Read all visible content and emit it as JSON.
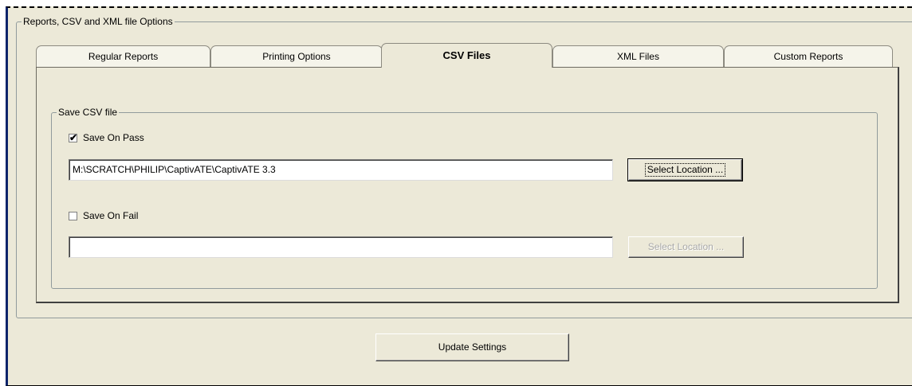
{
  "outer_group": {
    "title": "Reports, CSV and XML file Options"
  },
  "tabs": [
    {
      "label": "Regular Reports",
      "active": false
    },
    {
      "label": "Printing Options",
      "active": false
    },
    {
      "label": "CSV Files",
      "active": true
    },
    {
      "label": "XML Files",
      "active": false
    },
    {
      "label": "Custom Reports",
      "active": false
    }
  ],
  "csv": {
    "group_title": "Save CSV file",
    "save_on_pass": {
      "label": "Save On Pass",
      "checked": true,
      "path": "M:\\SCRATCH\\PHILIP\\CaptivATE\\CaptivATE 3.3",
      "button_label": "Select Location ...",
      "button_enabled": true
    },
    "save_on_fail": {
      "label": "Save On Fail",
      "checked": false,
      "path": "",
      "button_label": "Select Location ...",
      "button_enabled": false
    }
  },
  "footer": {
    "update_label": "Update Settings"
  },
  "icons": {
    "check_mark": "✔"
  },
  "colors": {
    "dialog_bg": "#ece9d8",
    "accent_border": "#0a246a",
    "disabled_text": "#a9a9a9"
  }
}
